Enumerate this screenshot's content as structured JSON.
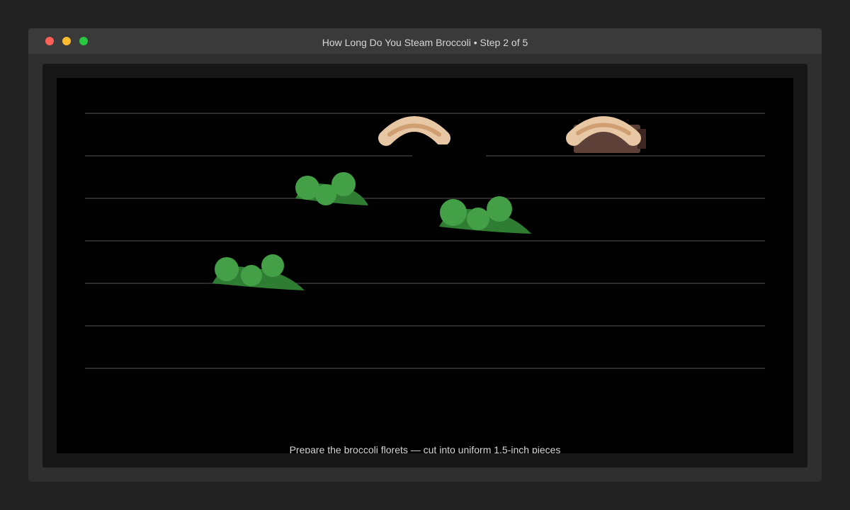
{
  "window": {
    "title": "How Long Do You Steam Broccoli • Step 2 of 5",
    "controls": {
      "close": "close-icon",
      "minimize": "minimize-icon",
      "zoom": "zoom-icon"
    }
  },
  "stage": {
    "caption": "Prepare the broccoli florets — cut into uniform 1.5-inch pieces"
  },
  "colors": {
    "desktop": "#232323",
    "window": "#2f2f2f",
    "titlebar": "#3a3a3a",
    "stage": "#000000",
    "broccoli_stalk": "#2e7d32",
    "broccoli_head": "#43a047",
    "hand": "#e8c7a4",
    "hand_shadow": "#cf9f72",
    "board": "#5d4037"
  }
}
